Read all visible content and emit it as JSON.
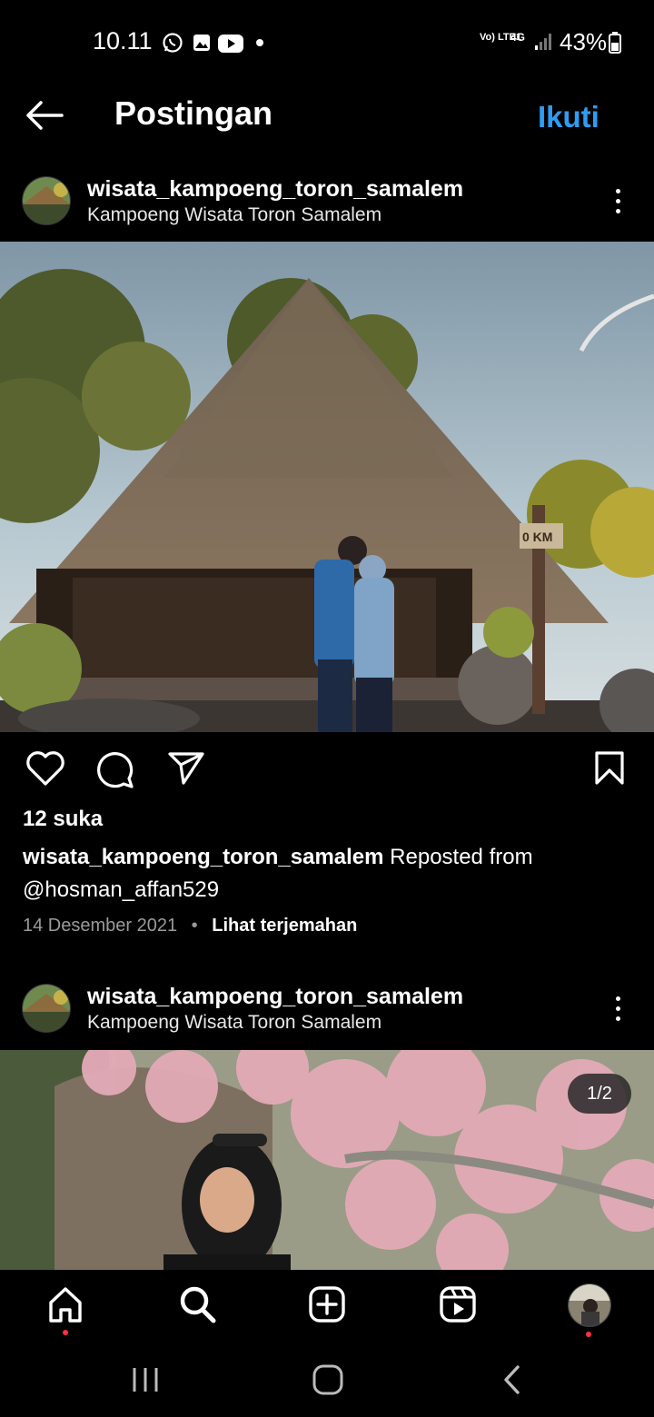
{
  "status_bar": {
    "time": "10.11",
    "network": "Vo) LTE1",
    "network_type": "4G",
    "battery": "43%"
  },
  "header": {
    "title": "Postingan",
    "follow_label": "Ikuti"
  },
  "posts": [
    {
      "username": "wisata_kampoeng_toron_samalem",
      "location": "Kampoeng Wisata Toron Samalem",
      "likes": "12 suka",
      "caption_user": "wisata_kampoeng_toron_samalem",
      "caption_text": " Reposted from",
      "caption_mention": "@hosman_affan529",
      "date": "14 Desember 2021",
      "translate_label": "Lihat terjemahan",
      "image_sign": "0 KM"
    },
    {
      "username": "wisata_kampoeng_toron_samalem",
      "location": "Kampoeng Wisata Toron Samalem",
      "page_indicator": "1/2"
    }
  ],
  "icons": {
    "back": "arrow-left-icon",
    "more": "more-vertical-icon",
    "like": "heart-icon",
    "comment": "comment-icon",
    "share": "send-icon",
    "save": "bookmark-icon",
    "nav": [
      "home-icon",
      "search-icon",
      "create-icon",
      "reels-icon",
      "profile-avatar"
    ]
  },
  "colors": {
    "accent": "#2f9cf4",
    "notification": "#ff3040"
  }
}
